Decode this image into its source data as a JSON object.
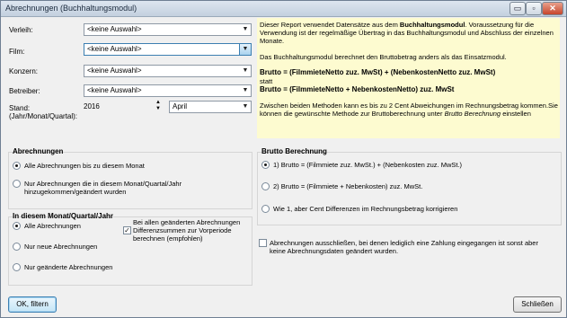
{
  "window": {
    "title": "Abrechnungen (Buchhaltungsmodul)",
    "btn_minimize": "▭",
    "btn_maximize": "▫",
    "btn_close": "✕"
  },
  "filters": {
    "verleih_label": "Verleih:",
    "verleih_value": "<keine Auswahl>",
    "film_label": "Film:",
    "film_value": "<keine Auswahl>",
    "konzern_label": "Konzern:",
    "konzern_value": "<keine Auswahl>",
    "betreiber_label": "Betreiber:",
    "betreiber_value": "<keine Auswahl>",
    "stand_label_1": "Stand:",
    "stand_label_2": "(Jahr/Monat/Quartal):",
    "year_value": "2016",
    "month_value": "April"
  },
  "info": {
    "p1_a": "Dieser Report verwendet Datensätze aus dem ",
    "p1_bold": "Buchhaltungsmodul",
    "p1_b": ". Voraussetzung für die",
    "p1_line2": "Verwendung ist der regelmäßige Übertrag in das Buchhaltungsmodul und Abschluss der einzelnen",
    "p1_line3": "Monate.",
    "p2": "Das Buchhaltungsmodul berechnet den Bruttobetrag anders als das Einsatzmodul.",
    "formula1": "Brutto = (FilmmieteNetto zuz. MwSt) + (NebenkostenNetto zuz. MwSt)",
    "statt": "statt",
    "formula2": "Brutto = (FilmmieteNetto + NebenkostenNetto) zuz. MwSt",
    "p3_line1": "Zwischen beiden Methoden kann es bis zu 2 Cent Abweichungen im Rechnungsbetrag kommen.Sie",
    "p3_line2a": "können die gewünschte Methode zur Bruttoberechnung unter ",
    "p3_italic": "Brutto  Berechnung",
    "p3_line2b": "  einstellen"
  },
  "abrechnungen": {
    "title": "Abrechnungen",
    "opt1": "Alle Abrechnungen bis zu diesem Monat",
    "opt2_line1": "Nur Abrechnungen die in diesem Monat/Quartal/Jahr",
    "opt2_line2": "hinzugekommen/geändert wurden"
  },
  "monat": {
    "title": "In diesem Monat/Quartal/Jahr",
    "opt1": "Alle Abrechnungen",
    "opt2": "Nur neue Abrechnungen",
    "opt3": "Nur geänderte Abrechnungen",
    "hint_line1": "Bei allen geänderten Abrechnungen",
    "cb_line1": "Differenzsummen zur Vorperiode",
    "cb_line2": "berechnen (empfohlen)"
  },
  "brutto": {
    "title": "Brutto Berechnung",
    "opt1": "1)  Brutto = (Filmmiete zuz. MwSt.) + (Nebenkosten zuz. MwSt.)",
    "opt2": "2)  Brutto = (Filmmiete + Nebenkosten) zuz. MwSt.",
    "opt3": "Wie 1, aber Cent Differenzen im Rechnungsbetrag korrigieren"
  },
  "exclude": {
    "line1": "Abrechnungen ausschließen, bei denen lediglich eine Zahlung eingegangen ist sonst aber",
    "line2": "keine Abrechnungsdaten geändert wurden."
  },
  "buttons": {
    "ok": "OK, filtern",
    "close": "Schließen"
  }
}
